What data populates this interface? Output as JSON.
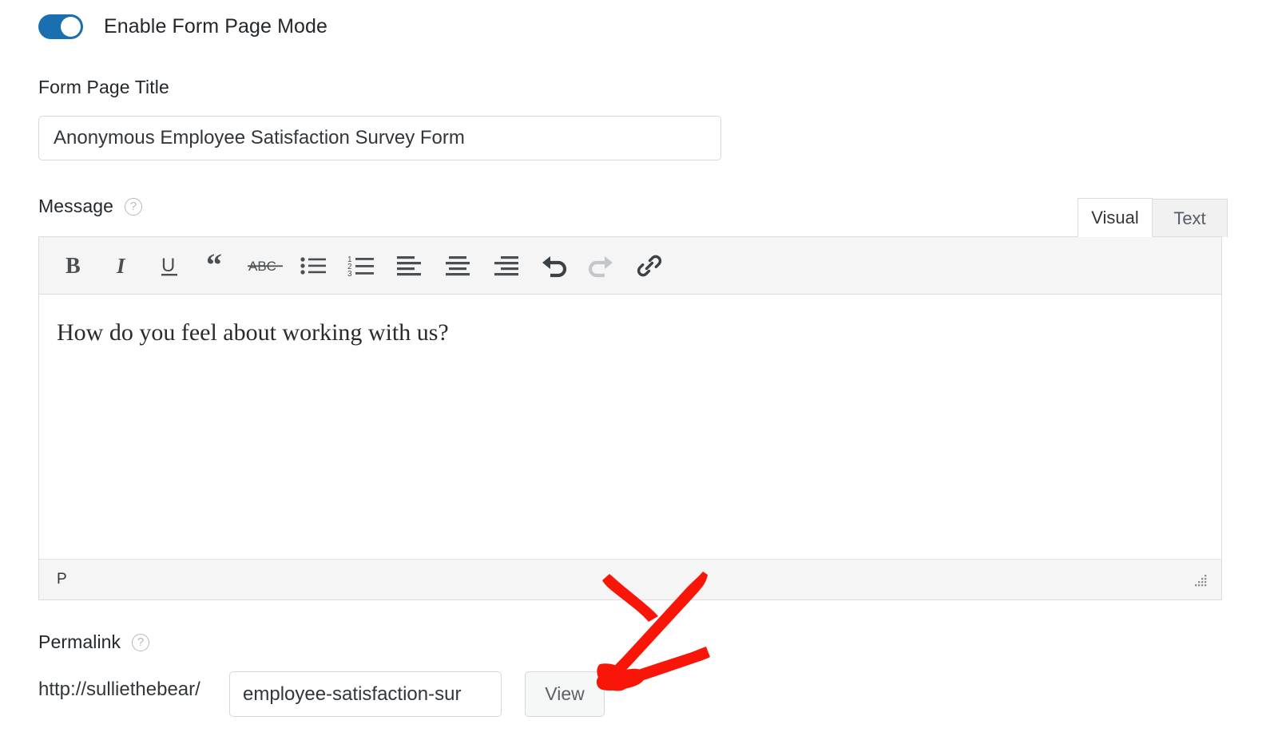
{
  "toggle": {
    "name": "enable-form-page-mode",
    "label": "Enable Form Page Mode",
    "state": "on",
    "accent_color": "#1a6fb0"
  },
  "form_page_title": {
    "label": "Form Page Title",
    "value": "Anonymous Employee Satisfaction Survey Form",
    "placeholder": ""
  },
  "message": {
    "label": "Message",
    "help_icon": "help-circle-icon",
    "help_glyph": "?",
    "tabs": [
      {
        "id": "visual",
        "label": "Visual",
        "active": true
      },
      {
        "id": "text",
        "label": "Text",
        "active": false
      }
    ],
    "toolbar": [
      {
        "id": "bold",
        "name": "bold-icon",
        "title": "Bold",
        "enabled": true
      },
      {
        "id": "italic",
        "name": "italic-icon",
        "title": "Italic",
        "enabled": true
      },
      {
        "id": "underline",
        "name": "underline-icon",
        "title": "Underline",
        "enabled": true
      },
      {
        "id": "blockquote",
        "name": "blockquote-icon",
        "title": "Blockquote",
        "enabled": true
      },
      {
        "id": "strikethrough",
        "name": "strikethrough-icon",
        "title": "Strikethrough",
        "enabled": true,
        "glyph": "ABC"
      },
      {
        "id": "bullet-list",
        "name": "unordered-list-icon",
        "title": "Bulleted list",
        "enabled": true
      },
      {
        "id": "numbered-list",
        "name": "ordered-list-icon",
        "title": "Numbered list",
        "enabled": true
      },
      {
        "id": "align-left",
        "name": "align-left-icon",
        "title": "Align left",
        "enabled": true
      },
      {
        "id": "align-center",
        "name": "align-center-icon",
        "title": "Align center",
        "enabled": true
      },
      {
        "id": "align-right",
        "name": "align-right-icon",
        "title": "Align right",
        "enabled": true
      },
      {
        "id": "undo",
        "name": "undo-icon",
        "title": "Undo",
        "enabled": true
      },
      {
        "id": "redo",
        "name": "redo-icon",
        "title": "Redo",
        "enabled": false
      },
      {
        "id": "link",
        "name": "link-icon",
        "title": "Insert/edit link",
        "enabled": true
      }
    ],
    "content": "How do you feel about working with us?",
    "status_path": "P",
    "resize_handle": "resize-grip-icon"
  },
  "permalink": {
    "label": "Permalink",
    "help_icon": "help-circle-icon",
    "help_glyph": "?",
    "base_url": "http://sulliethebear/",
    "slug": "employee-satisfaction-sur",
    "view_button": "View"
  },
  "annotation": {
    "type": "arrow",
    "color": "#f91508",
    "points_to": "view-button",
    "direction": "down-left"
  }
}
